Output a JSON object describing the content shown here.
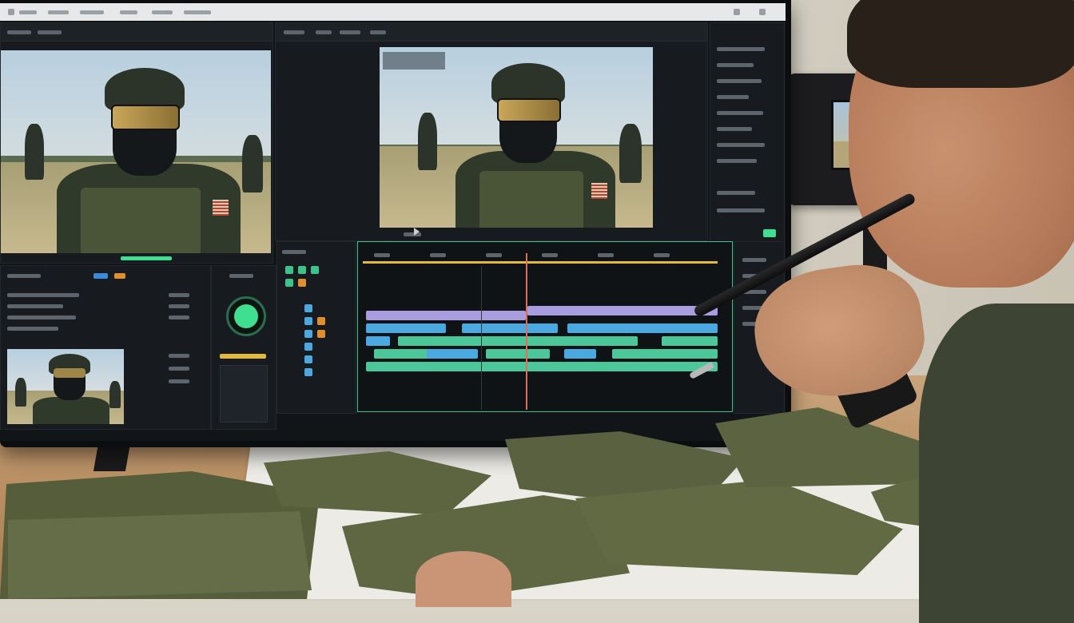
{
  "scene": {
    "description_free": true
  },
  "colors": {
    "timeline_border": "#3ac48a",
    "clip_purple": "#a99de0",
    "clip_blue": "#4aa9e0",
    "clip_green": "#4cc79a",
    "playhead": "#e96b4f",
    "gauge_green": "#3ee08f",
    "ruler_yellow": "#e2b93b",
    "fabric_olive": "#5c6440"
  },
  "icons": {
    "play": "play-icon",
    "gauge": "gauge-icon"
  }
}
